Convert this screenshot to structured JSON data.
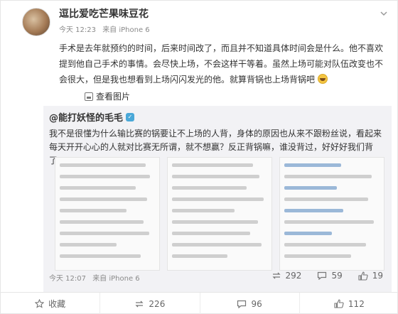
{
  "post": {
    "username": "逗比爱吃芒果味豆花",
    "time": "今天 12:23",
    "source": "来自 iPhone 6",
    "text": "手术是去年就预约的时间，后来时间改了，而且并不知道具体时间会是什么。他不喜欢提到他自己手术的事情。会尽快上场，不会这样干等着。虽然上场可能对队伍改变也不会很大，但是我也想看到上场闪闪发光的他。就算背锅也上场背锅吧",
    "view_pictures": "查看图片"
  },
  "repost": {
    "author": "@能打妖怪的毛毛",
    "text": "我不是很懂为什么输比赛的锅要让不上场的人背，身体的原因也从来不跟粉丝说，看起来每天开开心心的人就对比赛无所谓，就不想赢？反正背锅嘛，谁没背过，好好好我们背了。",
    "time": "今天 12:07",
    "source": "来自 iPhone 6",
    "repost_count": "292",
    "comment_count": "59",
    "like_count": "19"
  },
  "actions": {
    "favorite": "收藏",
    "repost": "226",
    "comment": "96",
    "like": "112"
  },
  "icons": {
    "more": "chevron-down-icon",
    "favorite": "star-icon",
    "repost": "repost-icon",
    "comment": "comment-icon",
    "like": "thumbs-up-icon"
  },
  "colors": {
    "repost_bg": "#f2f2f5",
    "vip_badge": "#4aa8d8"
  }
}
